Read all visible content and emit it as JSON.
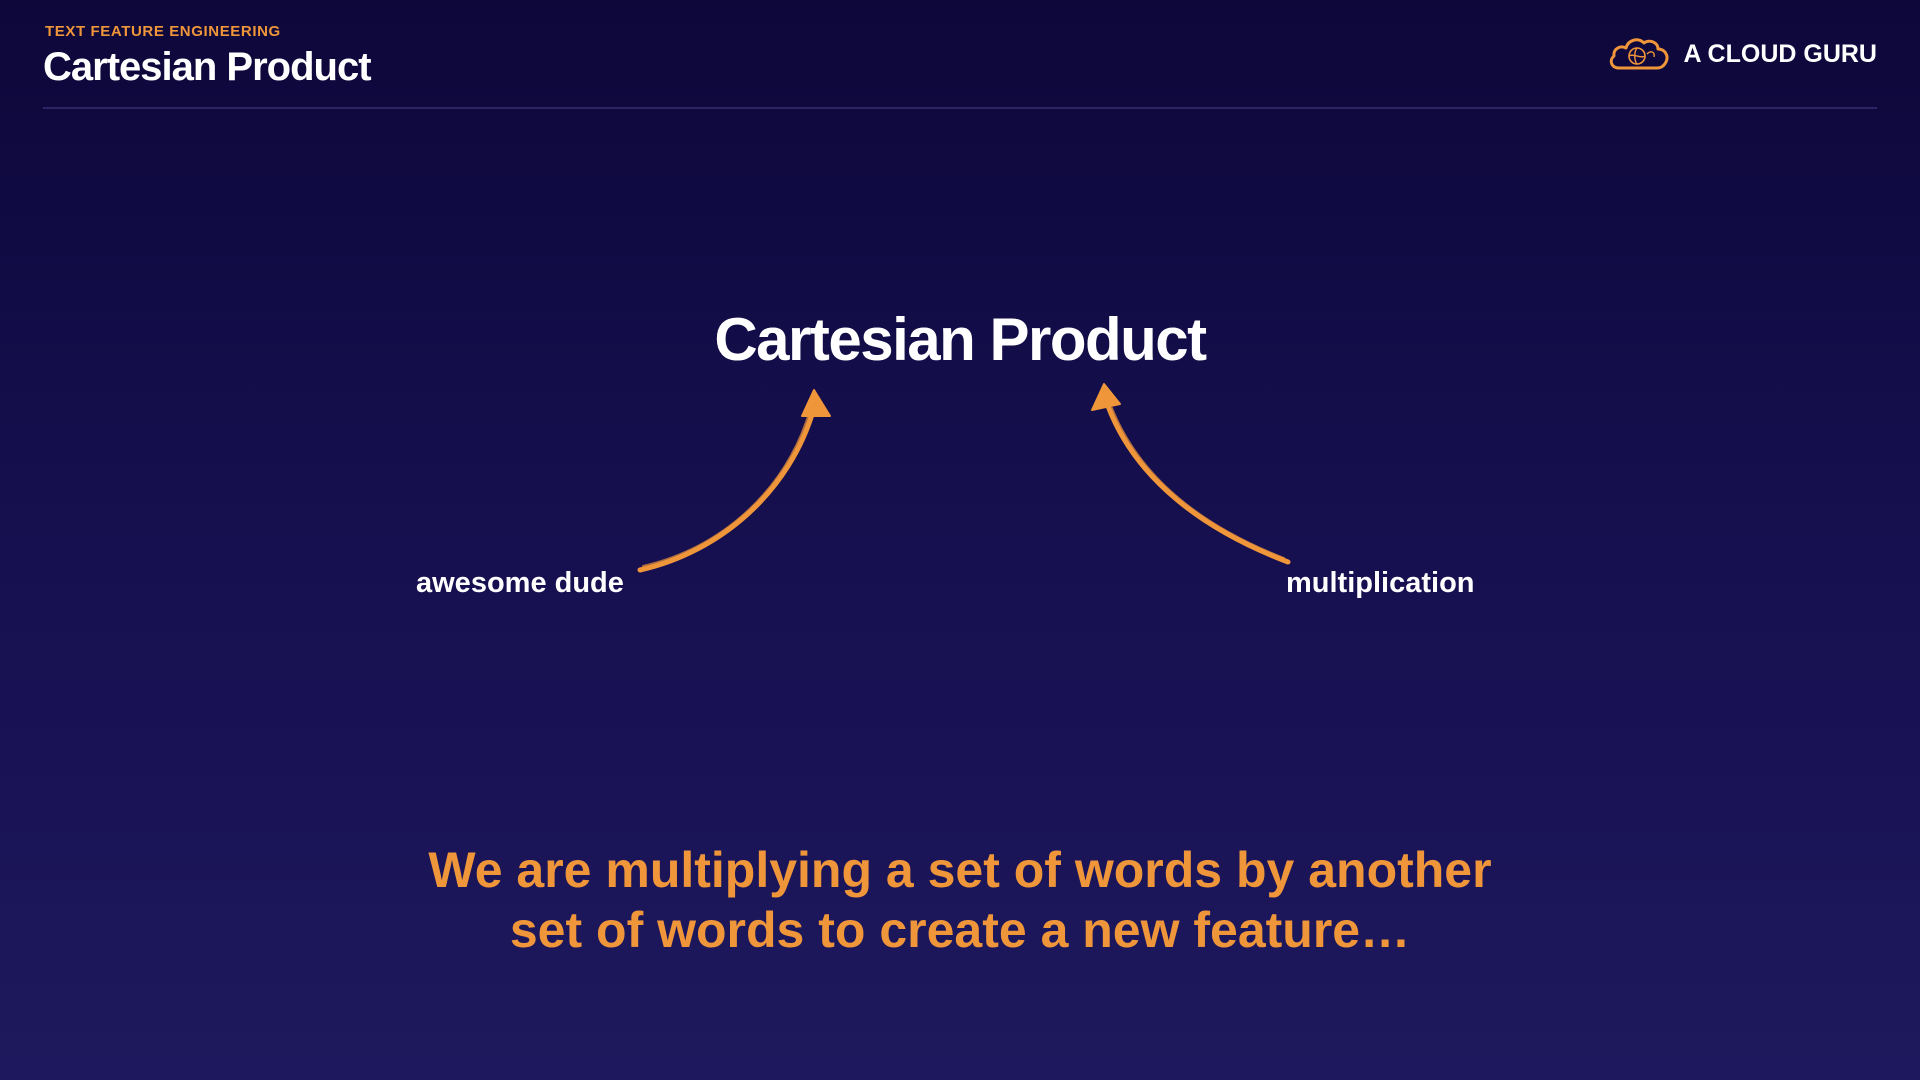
{
  "header": {
    "eyebrow": "TEXT FEATURE ENGINEERING",
    "title": "Cartesian Product",
    "brand_name": "A CLOUD GURU",
    "brand_logo_icon": "cloud-icon"
  },
  "diagram": {
    "center_term": "Cartesian Product",
    "left_label": "awesome dude",
    "right_label": "multiplication",
    "arrow_icon": "hand-drawn-arrow-icon"
  },
  "caption": {
    "line1": "We are multiplying a set of words by another",
    "line2": "set of words to create a new feature…"
  },
  "colors": {
    "accent": "#f0963a",
    "text": "#ffffff",
    "background_top": "#0d073a",
    "background_bottom": "#1e185e",
    "divider": "#2b2566"
  }
}
